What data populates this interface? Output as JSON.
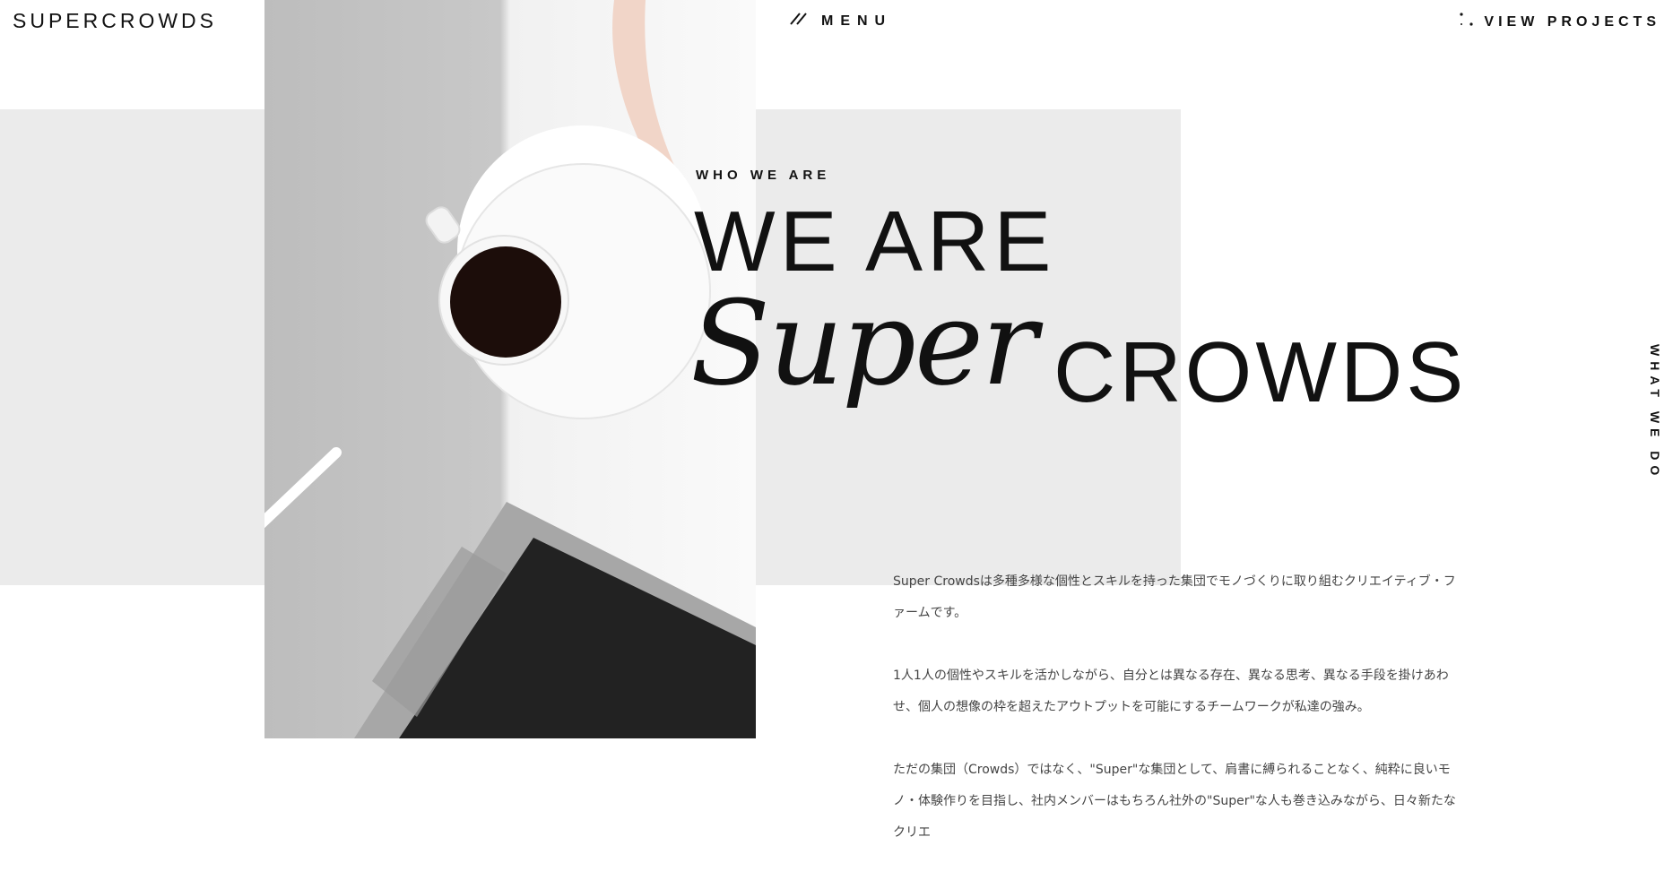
{
  "header": {
    "logo": "SUPERCROWDS",
    "menu_label": "MENU",
    "menu_icon": "slash-icon",
    "view_projects_label": "VIEW PROJECTS",
    "view_projects_icon": "dots-icon"
  },
  "hero": {
    "eyebrow": "WHO WE ARE",
    "headline_line1": "WE ARE",
    "headline_script": "Super",
    "headline_line2": "CROWDS",
    "photo_alt": "coffee-laptop-photo"
  },
  "side_nav": {
    "label": "WHAT WE DO"
  },
  "body": {
    "paragraphs": [
      "Super Crowdsは多種多様な個性とスキルを持った集団でモノづくりに取り組むクリエイティブ・ファームです。",
      "1人1人の個性やスキルを活かしながら、自分とは異なる存在、異なる思考、異なる手段を掛けあわせ、個人の想像の枠を超えたアウトプットを可能にするチームワークが私達の強み。",
      "ただの集団（Crowds）ではなく、\"Super\"な集団として、肩書に縛られることなく、純粋に良いモノ・体験作りを目指し、社内メンバーはもちろん社外の\"Super\"な人も巻き込みながら、日々新たなクリエ"
    ]
  },
  "colors": {
    "grey_panel": "#ebebeb",
    "text": "#111111",
    "body_text": "#444444"
  }
}
